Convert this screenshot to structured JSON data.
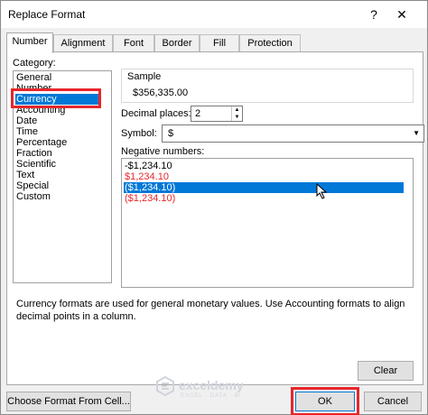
{
  "window": {
    "title": "Replace Format",
    "help": "?",
    "close": "✕"
  },
  "tabs": [
    "Number",
    "Alignment",
    "Font",
    "Border",
    "Fill",
    "Protection"
  ],
  "category": {
    "label": "Category:",
    "items": [
      "General",
      "Number",
      "Currency",
      "Accounting",
      "Date",
      "Time",
      "Percentage",
      "Fraction",
      "Scientific",
      "Text",
      "Special",
      "Custom"
    ],
    "selected_index": 2
  },
  "sample": {
    "label": "Sample",
    "value": "$356,335.00"
  },
  "decimal": {
    "label": "Decimal places:",
    "value": "2"
  },
  "symbol": {
    "label": "Symbol:",
    "value": "$"
  },
  "negative": {
    "label": "Negative numbers:",
    "items": [
      {
        "text": "-$1,234.10",
        "color": "#000000"
      },
      {
        "text": "$1,234.10",
        "color": "#e8262b"
      },
      {
        "text": "($1,234.10)",
        "color": "#000000"
      },
      {
        "text": "($1,234.10)",
        "color": "#e8262b"
      }
    ],
    "selected_index": 2
  },
  "description": "Currency formats are used for general monetary values.  Use Accounting formats to align decimal points in a column.",
  "buttons": {
    "clear": "Clear",
    "choose_format": "Choose Format From Cell...",
    "ok": "OK",
    "cancel": "Cancel"
  },
  "watermark": {
    "name": "exceldemy",
    "tagline": "EXCEL · DATA · BI"
  },
  "colors": {
    "selection": "#0078d7",
    "highlight": "#e8262b"
  }
}
